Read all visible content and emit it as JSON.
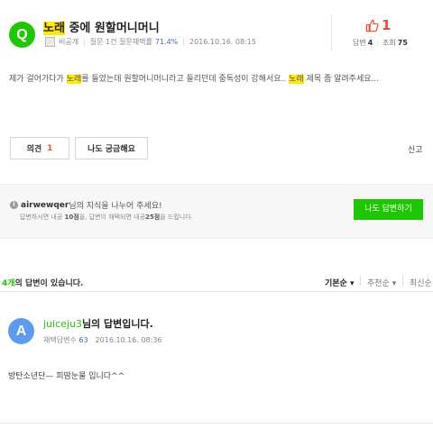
{
  "question": {
    "badge": "Q",
    "title_hl": "노래",
    "title_rest": " 중에 원할머니머니",
    "author": "비공개",
    "meta_label": "질문 1건 질문채택률",
    "adoption_rate": "71.4%",
    "date": "2016.10.16. 08:15",
    "likes": "1",
    "answers_label": "답변",
    "answers": "4",
    "views_label": "조회",
    "views": "75",
    "body_1": "제가 걸어가다가 ",
    "body_hl1": "노래",
    "body_2": "를 들었는데 원할머니머니라고 들리던데 중독성이 강해서요.. ",
    "body_hl2": "노래",
    "body_3": " 제목 좀 알려주세요..."
  },
  "buttons": {
    "opinion_label": "의견",
    "opinion_count": "1",
    "curious_label": "나도 궁금해요",
    "report_label": "신고"
  },
  "share": {
    "info_icon": "i",
    "user": "airwewqer",
    "line1_rest": "님의 지식을 나누어 주세요!",
    "line2_a": "답변하시면 내공 ",
    "line2_b": "10점",
    "line2_c": "을, 답변이 채택되면 내공",
    "line2_d": "25점",
    "line2_e": "을 드립니다.",
    "answer_button": "나도 답변하기"
  },
  "answers_header": {
    "count": "4개",
    "count_suffix": "의 답변이 있습니다.",
    "sort_default": "기본순",
    "sort_recommend": "추천순",
    "sort_latest": "최신순",
    "caret": "▾"
  },
  "answer": {
    "badge": "A",
    "user": "juiceju3",
    "title_suffix": "님의 답변입니다.",
    "adopted_label": "채택답변수",
    "adopted_count": "63",
    "date": "2016.10.16. 08:36",
    "body": "방탄소년단— 피땀눈물 입니다^^"
  },
  "colors": {
    "green": "#1ec800",
    "highlight": "#ffea00",
    "like_red": "#f04e23",
    "answer_blue": "#5b9cf0"
  }
}
